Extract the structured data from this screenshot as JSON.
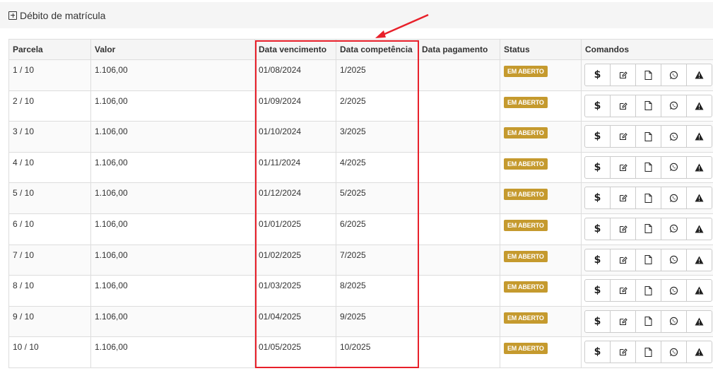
{
  "section": {
    "title": "Débito de matrícula",
    "toggle_icon": "plus-square-icon"
  },
  "table": {
    "headers": {
      "parcela": "Parcela",
      "valor": "Valor",
      "data_vencimento": "Data vencimento",
      "data_competencia": "Data competência",
      "data_pagamento": "Data pagamento",
      "status": "Status",
      "comandos": "Comandos"
    },
    "rows": [
      {
        "parcela": "1 / 10",
        "valor": "1.106,00",
        "vencimento": "01/08/2024",
        "competencia": "1/2025",
        "pagamento": "",
        "status": "EM ABERTO"
      },
      {
        "parcela": "2 / 10",
        "valor": "1.106,00",
        "vencimento": "01/09/2024",
        "competencia": "2/2025",
        "pagamento": "",
        "status": "EM ABERTO"
      },
      {
        "parcela": "3 / 10",
        "valor": "1.106,00",
        "vencimento": "01/10/2024",
        "competencia": "3/2025",
        "pagamento": "",
        "status": "EM ABERTO"
      },
      {
        "parcela": "4 / 10",
        "valor": "1.106,00",
        "vencimento": "01/11/2024",
        "competencia": "4/2025",
        "pagamento": "",
        "status": "EM ABERTO"
      },
      {
        "parcela": "5 / 10",
        "valor": "1.106,00",
        "vencimento": "01/12/2024",
        "competencia": "5/2025",
        "pagamento": "",
        "status": "EM ABERTO"
      },
      {
        "parcela": "6 / 10",
        "valor": "1.106,00",
        "vencimento": "01/01/2025",
        "competencia": "6/2025",
        "pagamento": "",
        "status": "EM ABERTO"
      },
      {
        "parcela": "7 / 10",
        "valor": "1.106,00",
        "vencimento": "01/02/2025",
        "competencia": "7/2025",
        "pagamento": "",
        "status": "EM ABERTO"
      },
      {
        "parcela": "8 / 10",
        "valor": "1.106,00",
        "vencimento": "01/03/2025",
        "competencia": "8/2025",
        "pagamento": "",
        "status": "EM ABERTO"
      },
      {
        "parcela": "9 / 10",
        "valor": "1.106,00",
        "vencimento": "01/04/2025",
        "competencia": "9/2025",
        "pagamento": "",
        "status": "EM ABERTO"
      },
      {
        "parcela": "10 / 10",
        "valor": "1.106,00",
        "vencimento": "01/05/2025",
        "competencia": "10/2025",
        "pagamento": "",
        "status": "EM ABERTO"
      }
    ],
    "commands": [
      {
        "name": "pay-button",
        "icon": "dollar-icon",
        "glyph": "$"
      },
      {
        "name": "edit-button",
        "icon": "edit-icon"
      },
      {
        "name": "document-button",
        "icon": "document-icon"
      },
      {
        "name": "whatsapp-button",
        "icon": "whatsapp-icon"
      },
      {
        "name": "warning-button",
        "icon": "warning-icon"
      }
    ]
  },
  "annotation": {
    "highlight_color": "#e8202a",
    "highlights": "Data vencimento / Data competência columns"
  },
  "colors": {
    "status_badge": "#c59a2e",
    "header_bg": "#f5f5f5",
    "border": "#dddddd"
  }
}
